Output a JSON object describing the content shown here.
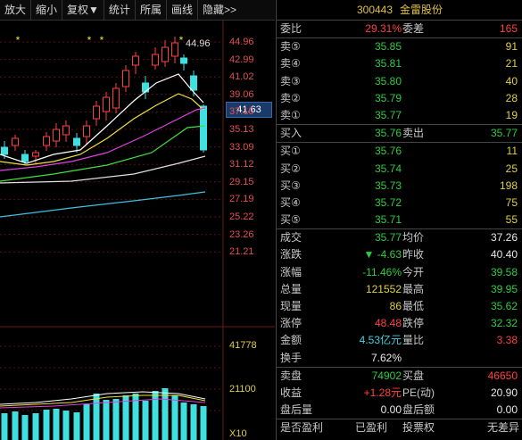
{
  "toolbar": {
    "items": [
      "放大",
      "缩小",
      "复权▼",
      "统计",
      "所属",
      "画线",
      "隐藏>>"
    ]
  },
  "chart": {
    "price_axis": [
      "44.96",
      "42.99",
      "41.02",
      "39.06",
      "37.10",
      "35.13",
      "33.09",
      "31.12",
      "29.15",
      "27.19",
      "25.22",
      "23.26",
      "21.21"
    ],
    "current_price_tag": "41.63",
    "high_label": "44.96",
    "volume_axis": [
      "41778",
      "21100",
      "X10"
    ],
    "star_glyph": "*"
  },
  "quote": {
    "code": "300443",
    "name": "金雷股份",
    "weibi": {
      "label": "委比",
      "value": "29.31%",
      "label2": "委差",
      "value2": "165"
    },
    "asks": [
      {
        "label": "卖⑤",
        "price": "35.85",
        "vol": "91"
      },
      {
        "label": "卖④",
        "price": "35.81",
        "vol": "21"
      },
      {
        "label": "卖③",
        "price": "35.80",
        "vol": "40"
      },
      {
        "label": "卖②",
        "price": "35.79",
        "vol": "28"
      },
      {
        "label": "卖①",
        "price": "35.77",
        "vol": "19"
      }
    ],
    "buy_sell_row": {
      "label": "买入",
      "price": "35.76",
      "label2": "卖出",
      "price2": "35.77"
    },
    "bids": [
      {
        "label": "买①",
        "price": "35.76",
        "vol": "11"
      },
      {
        "label": "买②",
        "price": "35.74",
        "vol": "25"
      },
      {
        "label": "买③",
        "price": "35.73",
        "vol": "198"
      },
      {
        "label": "买④",
        "price": "35.72",
        "vol": "75"
      },
      {
        "label": "买⑤",
        "price": "35.71",
        "vol": "55"
      }
    ],
    "stats": [
      {
        "l1": "成交",
        "v1": "35.77",
        "c1": "green",
        "l2": "均价",
        "v2": "37.26",
        "c2": "white"
      },
      {
        "l1": "涨跌",
        "v1": "▼ -4.63",
        "c1": "green",
        "l2": "昨收",
        "v2": "40.40",
        "c2": "white"
      },
      {
        "l1": "涨幅",
        "v1": "-11.46%",
        "c1": "green",
        "l2": "今开",
        "v2": "39.58",
        "c2": "green"
      },
      {
        "l1": "总量",
        "v1": "121552",
        "c1": "yellow",
        "l2": "最高",
        "v2": "39.95",
        "c2": "green"
      },
      {
        "l1": "现量",
        "v1": "86",
        "c1": "yellow",
        "l2": "最低",
        "v2": "35.62",
        "c2": "green"
      },
      {
        "l1": "涨停",
        "v1": "48.48",
        "c1": "red",
        "l2": "跌停",
        "v2": "32.32",
        "c2": "green"
      },
      {
        "l1": "金额",
        "v1": "4.53亿元",
        "c1": "cyan",
        "l2": "量比",
        "v2": "3.38",
        "c2": "red"
      },
      {
        "l1": "换手",
        "v1": "7.62%",
        "c1": "white",
        "l2": "",
        "v2": "",
        "c2": "white"
      }
    ],
    "pan": [
      {
        "l1": "卖盘",
        "v1": "74902",
        "c1": "green",
        "l2": "买盘",
        "v2": "46650",
        "c2": "red"
      },
      {
        "l1": "收益",
        "v1": "+1.28元",
        "c1": "red",
        "l2": "PE(动)",
        "v2": "20.90",
        "c2": "white"
      },
      {
        "l1": "盘后量",
        "v1": "0.00",
        "c1": "white",
        "l2": "盘后额",
        "v2": "0.00",
        "c2": "white"
      }
    ],
    "bottom_cut": [
      "是否盈利",
      "已盈利",
      "投票权",
      "无差异"
    ]
  },
  "colors": {
    "up": "#ff4040",
    "down": "#40e0e0",
    "ma5": "#ffffff",
    "ma10": "#f0e040",
    "ma20": "#e040e0",
    "ma30": "#40e040",
    "ma60": "#e0e0e0",
    "ma120": "#40c0e0"
  }
}
